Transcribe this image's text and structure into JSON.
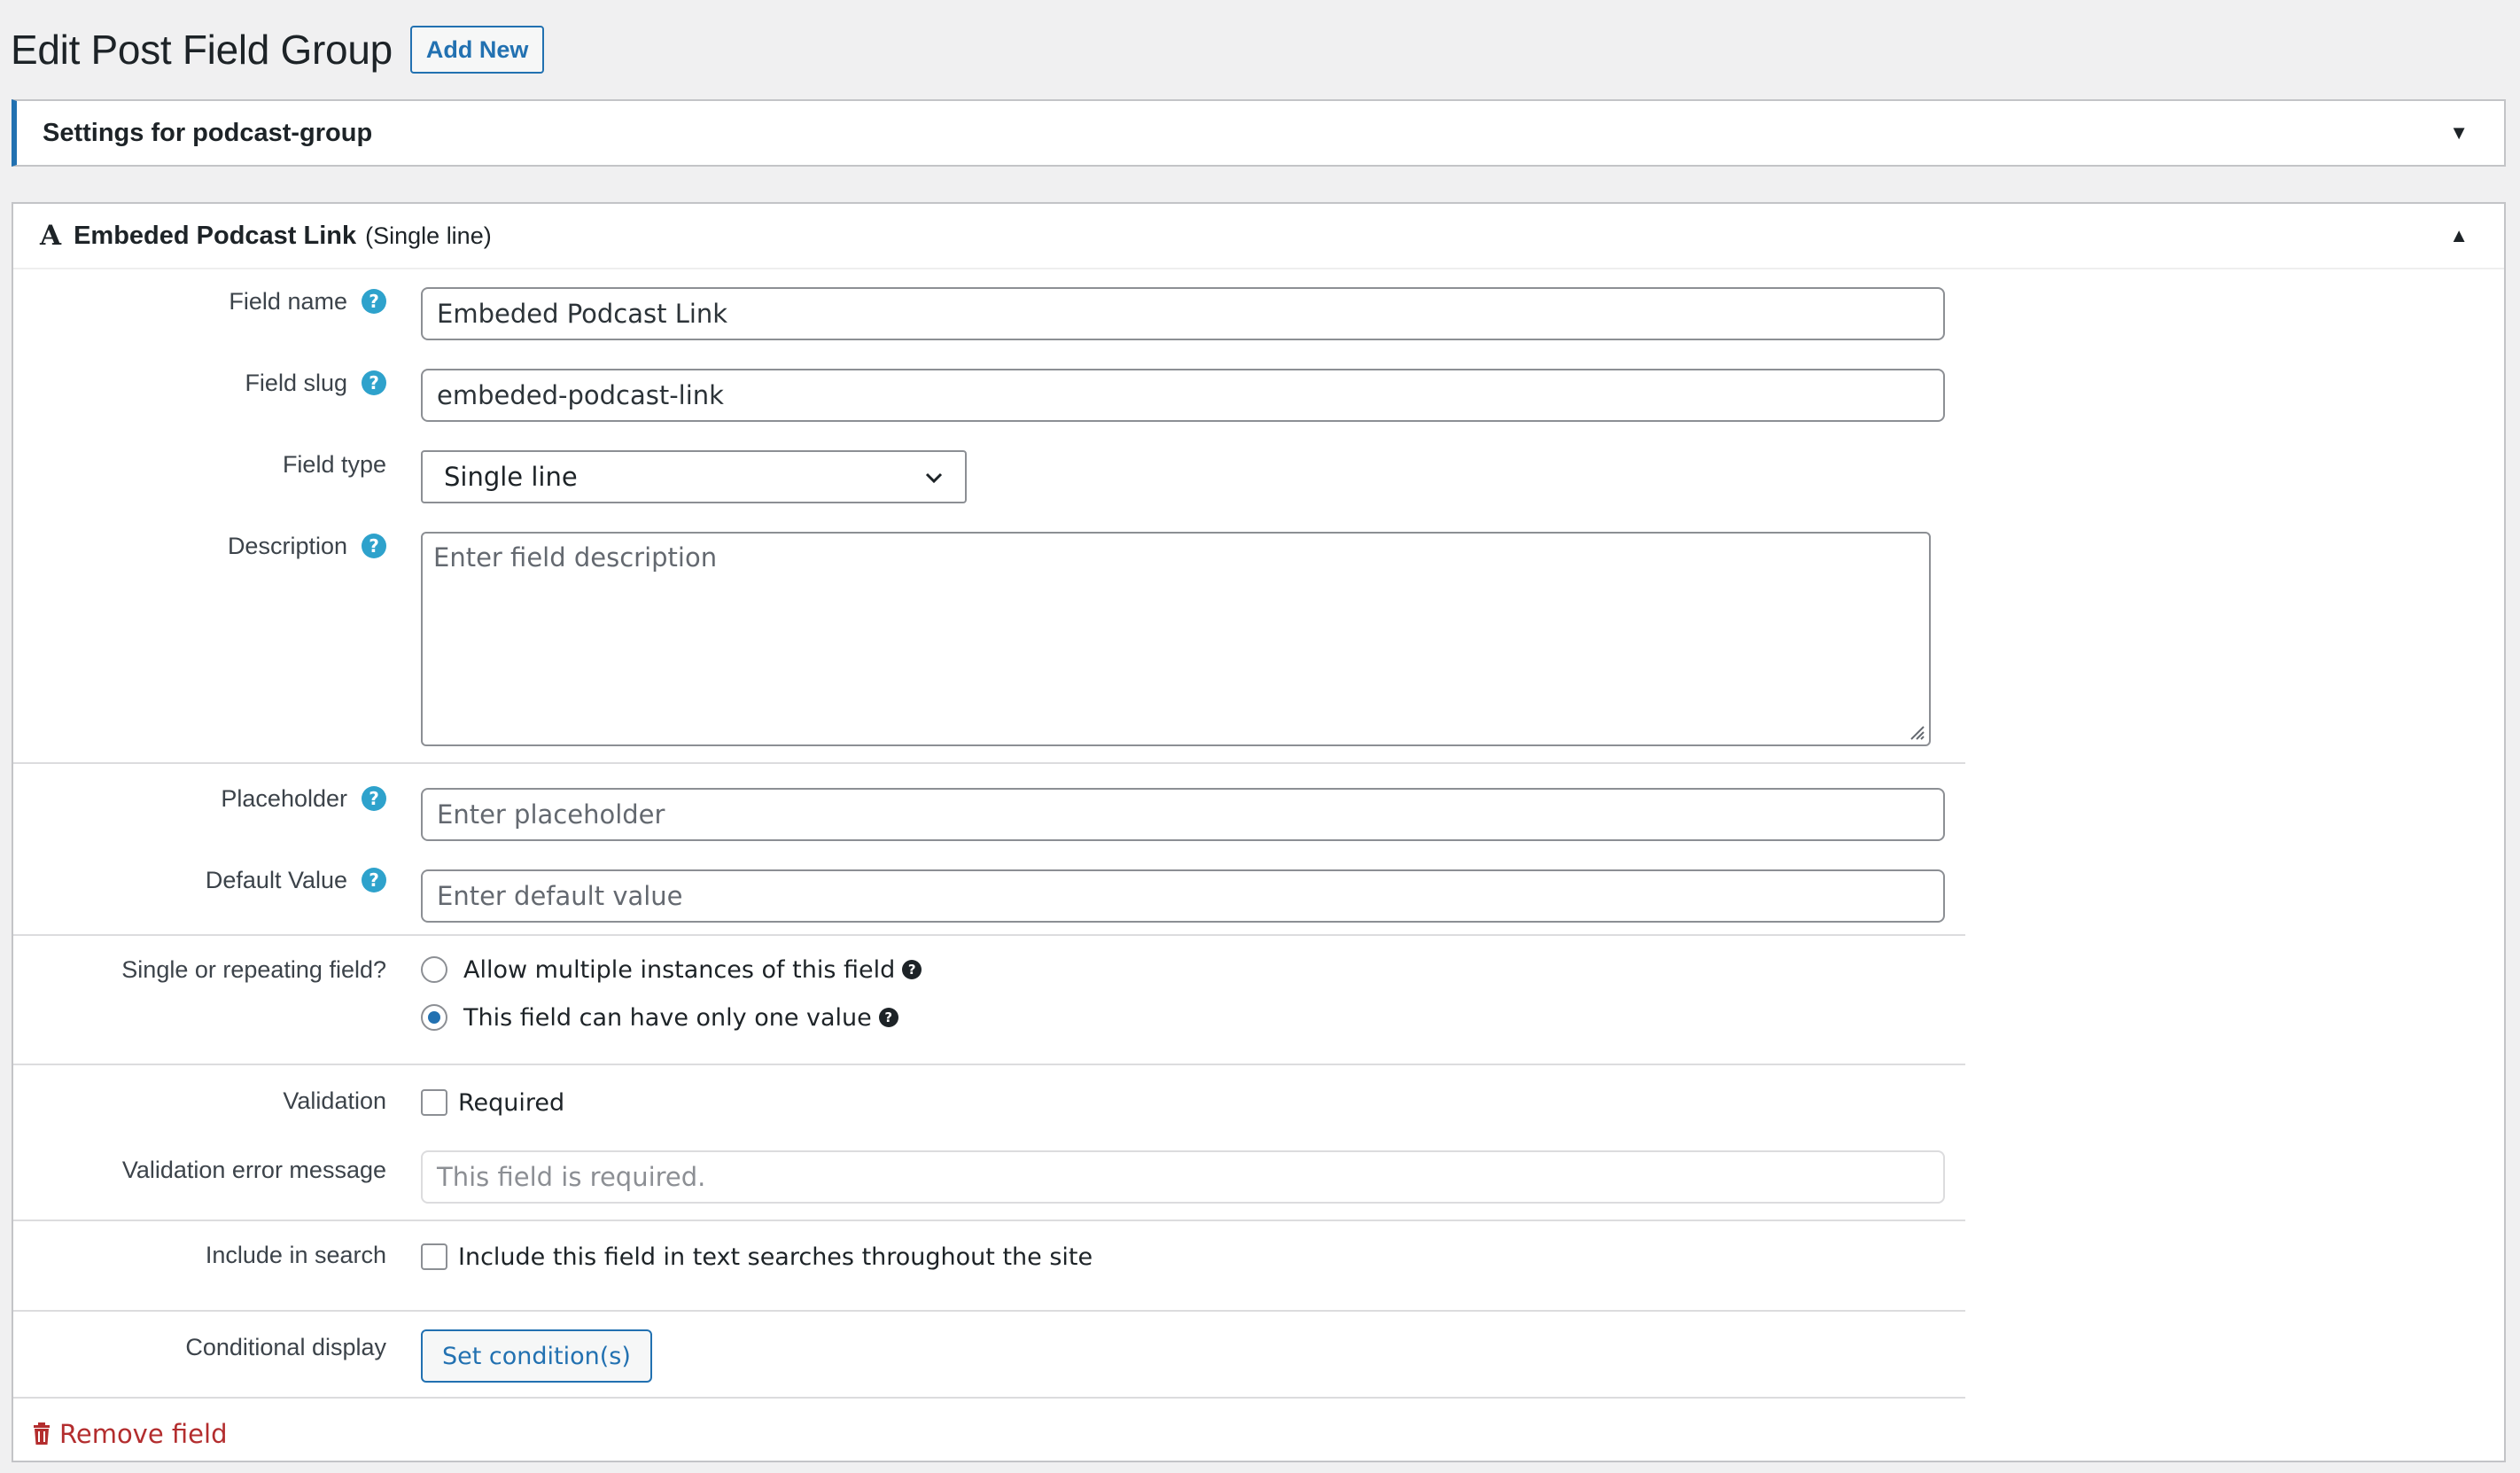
{
  "header": {
    "title": "Edit Post Field Group",
    "add_new": "Add New"
  },
  "settings": {
    "title": "Settings for podcast-group"
  },
  "field": {
    "icon": "A",
    "title": "Embeded Podcast Link",
    "type_note": "(Single line)",
    "labels": {
      "field_name": "Field name",
      "field_slug": "Field slug",
      "field_type": "Field type",
      "description": "Description",
      "placeholder": "Placeholder",
      "default_value": "Default Value",
      "single_or_repeating": "Single or repeating field?",
      "validation": "Validation",
      "validation_error": "Validation error message",
      "include_search": "Include in search",
      "conditional": "Conditional display"
    },
    "values": {
      "field_name": "Embeded Podcast Link",
      "field_slug": "embeded-podcast-link",
      "field_type": "Single line"
    },
    "placeholders": {
      "description": "Enter field description",
      "placeholder": "Enter placeholder",
      "default_value": "Enter default value",
      "validation_error": "This field is required."
    },
    "options": {
      "multiple": "Allow multiple instances of this field",
      "single": "This field can have only one value",
      "single_selected": true,
      "required": "Required",
      "required_checked": false,
      "include_search": "Include this field in text searches throughout the site",
      "include_search_checked": false
    },
    "buttons": {
      "set_conditions": "Set condition(s)",
      "remove": "Remove field"
    }
  },
  "colors": {
    "accent": "#2271b1",
    "help": "#2ea2cc",
    "danger": "#b32d2e",
    "border": "#c3c4c7"
  }
}
